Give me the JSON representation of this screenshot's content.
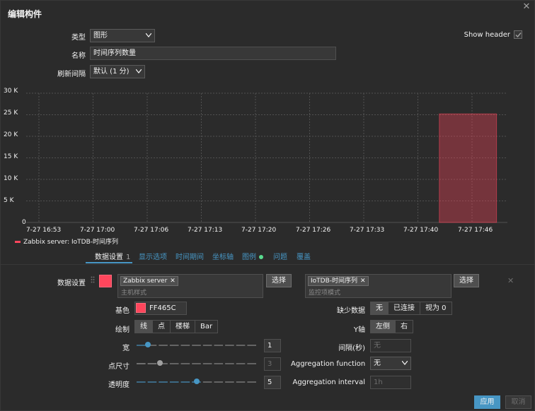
{
  "dialog": {
    "title": "编辑构件"
  },
  "form": {
    "type_label": "类型",
    "type_value": "图形",
    "name_label": "名称",
    "name_value": "时间序列数量",
    "refresh_label": "刷新间隔",
    "refresh_value": "默认 (1 分)",
    "show_header_label": "Show header",
    "show_header_checked": true
  },
  "chart_data": {
    "type": "bar",
    "y_ticks": [
      "30 K",
      "25 K",
      "20 K",
      "15 K",
      "10 K",
      "5 K",
      "0"
    ],
    "ylim": [
      0,
      30000
    ],
    "x_ticks": [
      "7-27 16:53",
      "7-27 17:00",
      "7-27 17:06",
      "7-27 17:13",
      "7-27 17:20",
      "7-27 17:26",
      "7-27 17:33",
      "7-27 17:40",
      "7-27 17:46"
    ],
    "series": [
      {
        "name": "Zabbix server: IoTDB-时间序列",
        "color": "#ff465c",
        "bars": [
          {
            "x_start": "7-27 17:42",
            "x_end": "7-27 17:49",
            "value": 25200
          }
        ]
      }
    ],
    "grid": true,
    "legend": "bottom-left"
  },
  "legend": {
    "label": "Zabbix server: IoTDB-时间序列"
  },
  "tabs": [
    {
      "label": "数据设置",
      "badge": "1"
    },
    {
      "label": "显示选项"
    },
    {
      "label": "时间期间"
    },
    {
      "label": "坐标轴"
    },
    {
      "label": "图例"
    },
    {
      "label": "问题"
    },
    {
      "label": "覆盖"
    }
  ],
  "dataset": {
    "label": "数据设置",
    "host_chip": "Zabbix server",
    "host_placeholder": "主机样式",
    "select_label": "选择",
    "item_chip": "IoTDB-时间序列",
    "item_placeholder": "监控项模式",
    "base_label": "基色",
    "base_color": "FF465C",
    "draw_label": "绘制",
    "draw_options": [
      "线",
      "点",
      "楼梯",
      "Bar"
    ],
    "draw_selected": "线",
    "width_label": "宽",
    "width_value": "1",
    "width_level": 0.1,
    "pointsize_label": "点尺寸",
    "pointsize_value": "3",
    "pointsize_level": 0.2,
    "transparency_label": "透明度",
    "transparency_value": "5",
    "transparency_level": 0.5,
    "missing_label": "缺少数据",
    "missing_options": [
      "无",
      "已连接",
      "视为 0"
    ],
    "missing_selected": "无",
    "yaxis_label": "Y轴",
    "yaxis_options": [
      "左侧",
      "右"
    ],
    "yaxis_selected": "左侧",
    "interval_label": "间隔(秒)",
    "interval_placeholder": "无",
    "agg_func_label": "Aggregation function",
    "agg_func_value": "无",
    "agg_interval_label": "Aggregation interval",
    "agg_interval_placeholder": "1h"
  },
  "footer": {
    "apply": "应用",
    "cancel": "取消"
  }
}
